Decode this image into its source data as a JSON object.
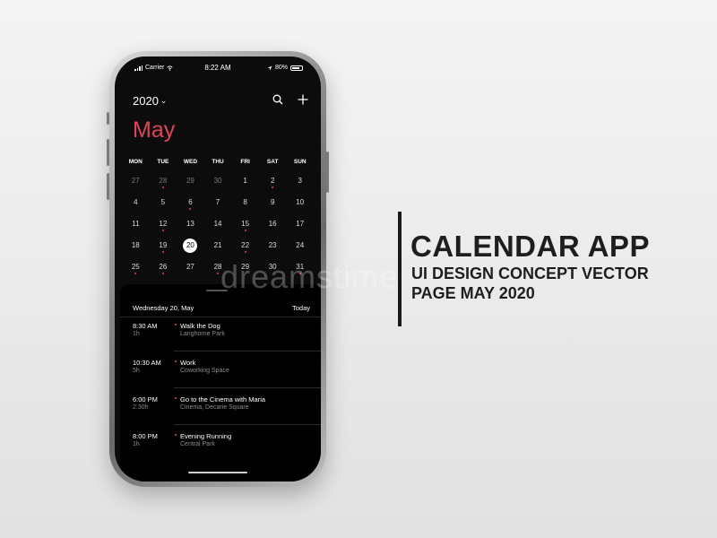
{
  "status_bar": {
    "carrier": "Carrier",
    "time": "8:22 AM",
    "battery": "80%"
  },
  "header": {
    "year": "2020",
    "search_icon": "search-icon",
    "add_icon": "plus-icon"
  },
  "month": "May",
  "weekdays": [
    "MON",
    "TUE",
    "WED",
    "THU",
    "FRI",
    "SAT",
    "SUN"
  ],
  "weeks": [
    [
      {
        "d": "27",
        "muted": true,
        "dot": false
      },
      {
        "d": "28",
        "muted": true,
        "dot": true
      },
      {
        "d": "29",
        "muted": true,
        "dot": false
      },
      {
        "d": "30",
        "muted": true,
        "dot": false
      },
      {
        "d": "1",
        "muted": false,
        "dot": false
      },
      {
        "d": "2",
        "muted": false,
        "dot": true
      },
      {
        "d": "3",
        "muted": false,
        "dot": false
      }
    ],
    [
      {
        "d": "4",
        "muted": false,
        "dot": false
      },
      {
        "d": "5",
        "muted": false,
        "dot": false
      },
      {
        "d": "6",
        "muted": false,
        "dot": true
      },
      {
        "d": "7",
        "muted": false,
        "dot": false
      },
      {
        "d": "8",
        "muted": false,
        "dot": false
      },
      {
        "d": "9",
        "muted": false,
        "dot": false
      },
      {
        "d": "10",
        "muted": false,
        "dot": false
      }
    ],
    [
      {
        "d": "11",
        "muted": false,
        "dot": false
      },
      {
        "d": "12",
        "muted": false,
        "dot": true
      },
      {
        "d": "13",
        "muted": false,
        "dot": false
      },
      {
        "d": "14",
        "muted": false,
        "dot": false
      },
      {
        "d": "15",
        "muted": false,
        "dot": true
      },
      {
        "d": "16",
        "muted": false,
        "dot": false
      },
      {
        "d": "17",
        "muted": false,
        "dot": false
      }
    ],
    [
      {
        "d": "18",
        "muted": false,
        "dot": false
      },
      {
        "d": "19",
        "muted": false,
        "dot": true
      },
      {
        "d": "20",
        "muted": false,
        "dot": false,
        "today": true
      },
      {
        "d": "21",
        "muted": false,
        "dot": false
      },
      {
        "d": "22",
        "muted": false,
        "dot": true
      },
      {
        "d": "23",
        "muted": false,
        "dot": false
      },
      {
        "d": "24",
        "muted": false,
        "dot": false
      }
    ],
    [
      {
        "d": "25",
        "muted": false,
        "dot": true
      },
      {
        "d": "26",
        "muted": false,
        "dot": true
      },
      {
        "d": "27",
        "muted": false,
        "dot": false
      },
      {
        "d": "28",
        "muted": false,
        "dot": true
      },
      {
        "d": "29",
        "muted": false,
        "dot": false
      },
      {
        "d": "30",
        "muted": false,
        "dot": false
      },
      {
        "d": "31",
        "muted": false,
        "dot": true
      }
    ]
  ],
  "agenda": {
    "date_label": "Wednesday 20, May",
    "today_link": "Today",
    "events": [
      {
        "time": "8:30 AM",
        "duration": "1h",
        "title": "Walk the Dog",
        "location": "Langhorne Park"
      },
      {
        "time": "10:30 AM",
        "duration": "5h",
        "title": "Work",
        "location": "Coworking Space"
      },
      {
        "time": "6:00 PM",
        "duration": "2.30h",
        "title": "Go to the Cinema with Maria",
        "location": "Cinema, Decarie Square"
      },
      {
        "time": "8:00 PM",
        "duration": "1h",
        "title": "Evening Running",
        "location": "Central Park"
      }
    ]
  },
  "watermark": "dreamstime",
  "promo": {
    "line1": "CALENDAR APP",
    "line2": "UI DESIGN CONCEPT VECTOR",
    "line3": "PAGE MAY 2020"
  },
  "colors": {
    "accent": "#e0435a",
    "screen_bg": "#0c0c0c",
    "sheet_bg": "#000000"
  }
}
